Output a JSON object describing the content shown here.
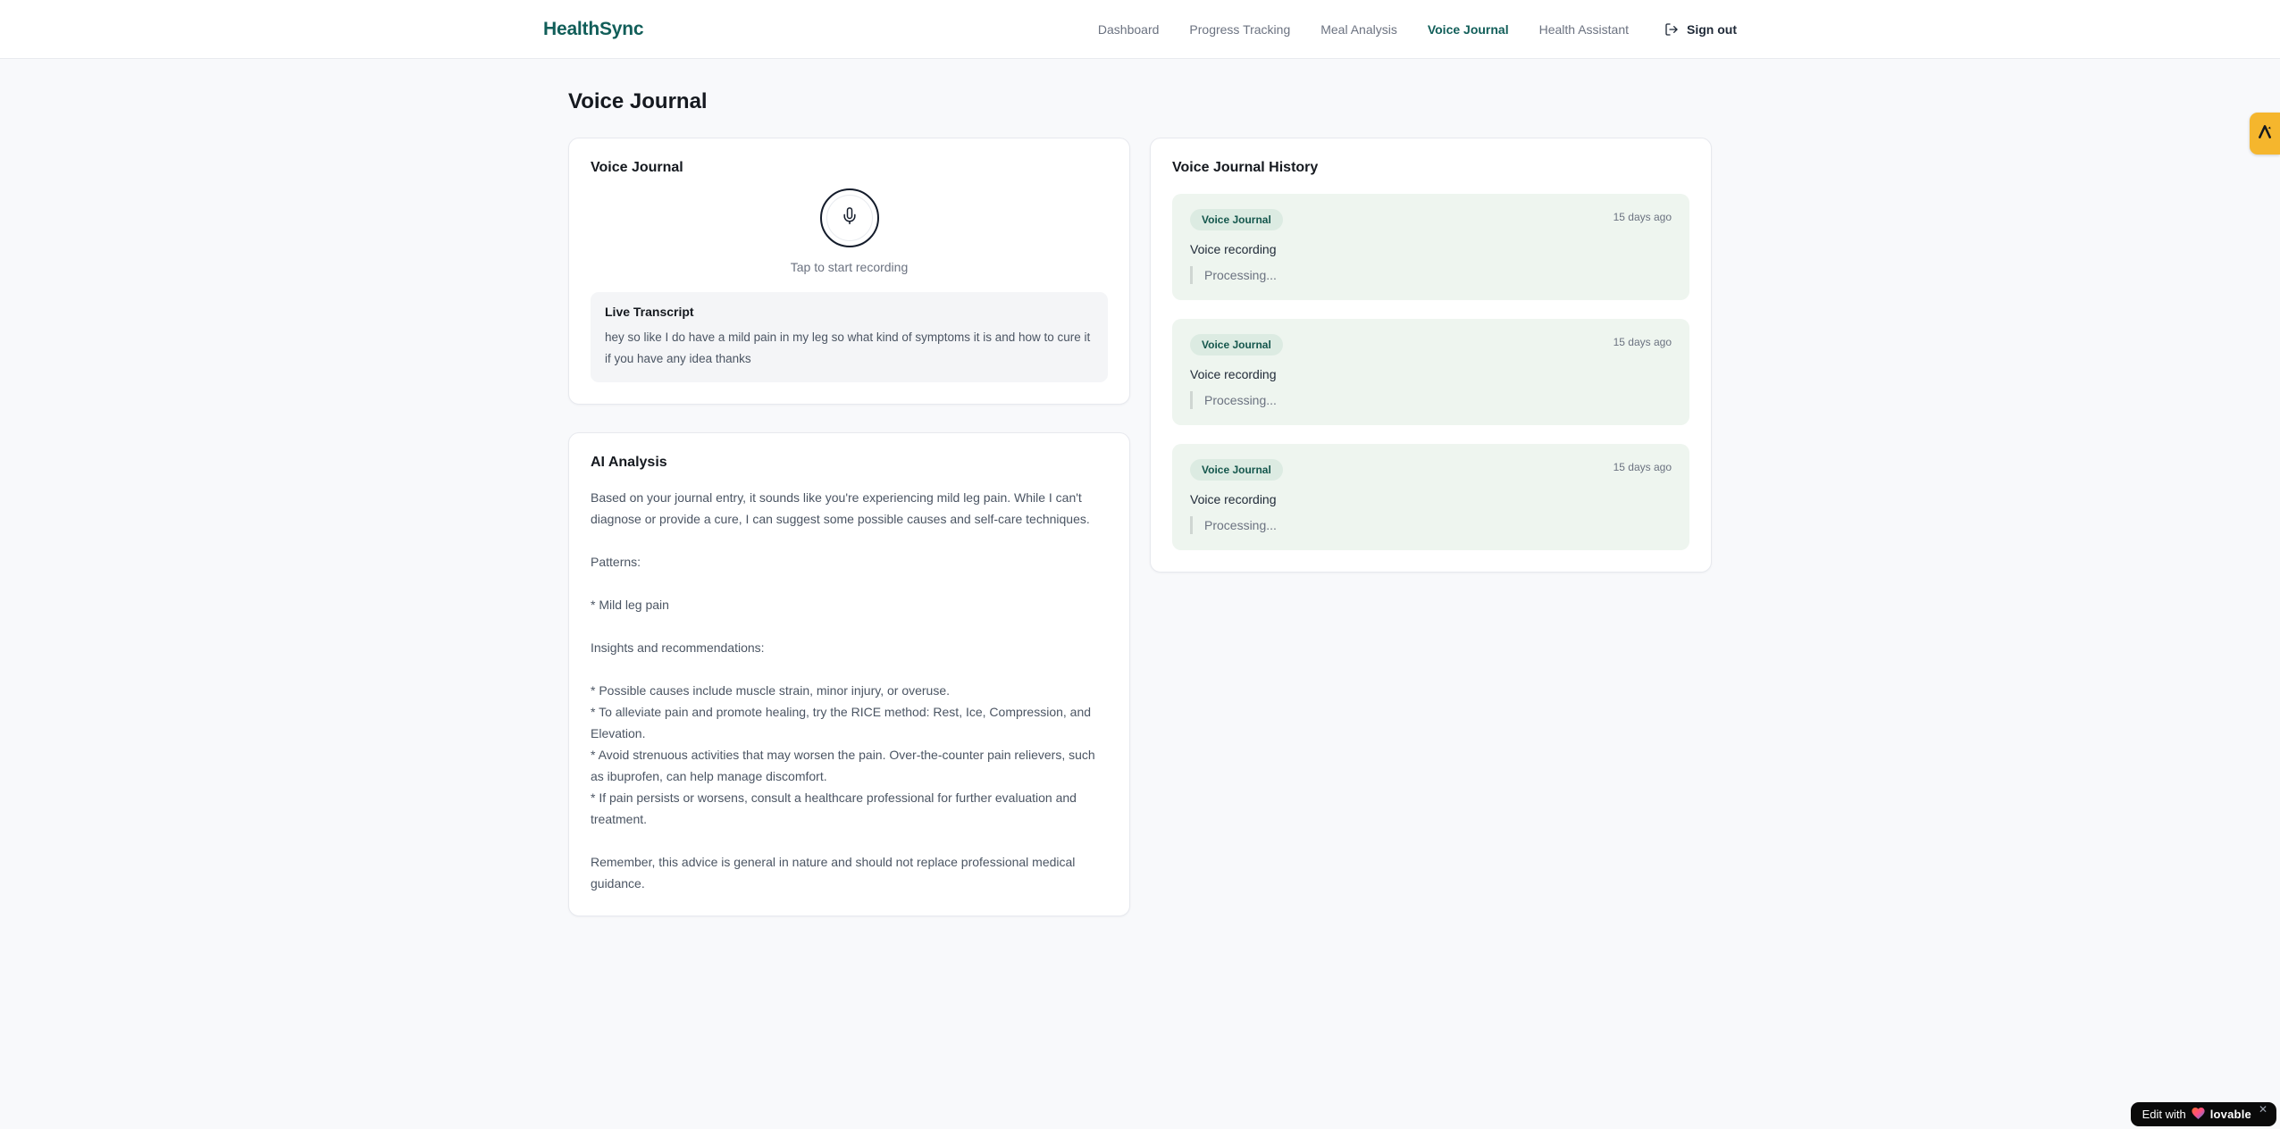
{
  "brand": {
    "name": "HealthSync"
  },
  "nav": {
    "items": [
      {
        "label": "Dashboard",
        "active": false
      },
      {
        "label": "Progress Tracking",
        "active": false
      },
      {
        "label": "Meal Analysis",
        "active": false
      },
      {
        "label": "Voice Journal",
        "active": true
      },
      {
        "label": "Health Assistant",
        "active": false
      }
    ],
    "sign_out_label": "Sign out"
  },
  "page": {
    "title": "Voice Journal"
  },
  "recorder_card": {
    "title": "Voice Journal",
    "tap_hint": "Tap to start recording",
    "transcript_title": "Live Transcript",
    "transcript_text": "hey so like I do have a mild pain in my leg so what kind of symptoms it is and how to cure it if you have any idea thanks"
  },
  "analysis_card": {
    "title": "AI Analysis",
    "paragraphs": [
      "Based on your journal entry, it sounds like you're experiencing mild leg pain. While I can't diagnose or provide a cure, I can suggest some possible causes and self-care techniques.",
      "Patterns:",
      "* Mild leg pain",
      "Insights and recommendations:",
      "* Possible causes include muscle strain, minor injury, or overuse.\n* To alleviate pain and promote healing, try the RICE method: Rest, Ice, Compression, and Elevation.\n* Avoid strenuous activities that may worsen the pain. Over-the-counter pain relievers, such as ibuprofen, can help manage discomfort.\n* If pain persists or worsens, consult a healthcare professional for further evaluation and treatment.",
      "Remember, this advice is general in nature and should not replace professional medical guidance."
    ]
  },
  "history_card": {
    "title": "Voice Journal History",
    "entries": [
      {
        "badge": "Voice Journal",
        "time": "15 days ago",
        "summary": "Voice recording",
        "status": "Processing..."
      },
      {
        "badge": "Voice Journal",
        "time": "15 days ago",
        "summary": "Voice recording",
        "status": "Processing..."
      },
      {
        "badge": "Voice Journal",
        "time": "15 days ago",
        "summary": "Voice recording",
        "status": "Processing..."
      }
    ]
  },
  "overlays": {
    "lovable": {
      "prefix": "Edit with",
      "brand": "lovable",
      "close": "✕"
    }
  },
  "colors": {
    "brand_green": "#115e59",
    "history_entry_bg": "#eef5ef",
    "badge_bg": "#dcebe2",
    "badge_text": "#14564c",
    "extension_yellow": "#f5b62d",
    "lovable_black": "#0a0a0a",
    "page_bg": "#f8f9fb"
  }
}
